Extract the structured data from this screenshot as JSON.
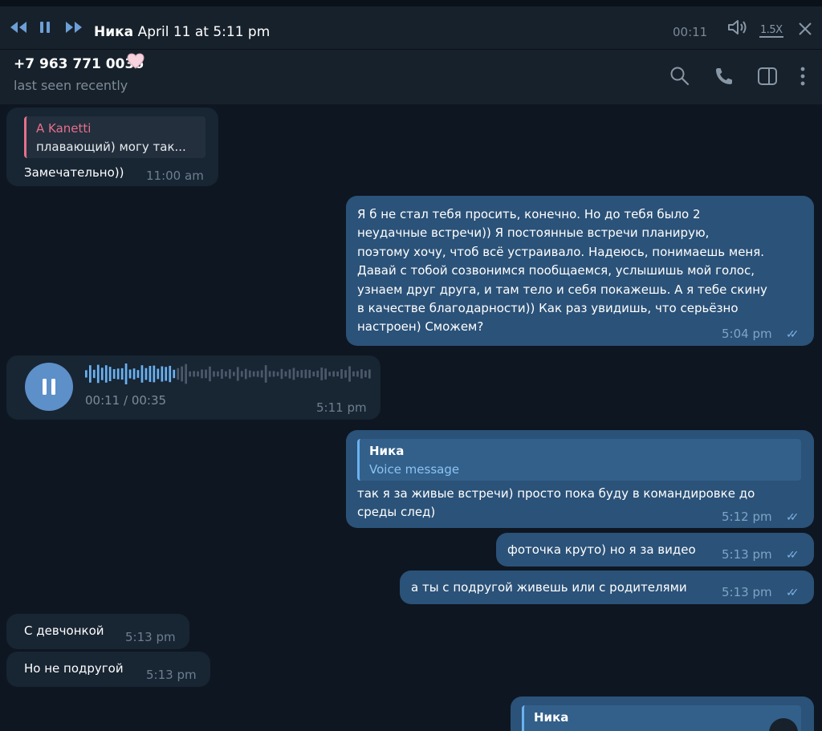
{
  "player": {
    "sender": "Ника",
    "date": "April 11 at 5:11 pm",
    "position": "00:11",
    "speed": "1.5X"
  },
  "chat": {
    "name": "+7 963 771 0036",
    "status": "last seen recently"
  },
  "messages": [
    {
      "reply_name": "A Kanetti",
      "reply_text": "плавающий) могу так...",
      "text": "Замечательно))",
      "time": "11:00 am"
    },
    {
      "lines": [
        "Я б не стал тебя просить, конечно. Но до тебя было 2",
        "неудачные встречи))  Я постоянные встречи планирую,",
        "поэтому хочу, чтоб всё устраивало. Надеюсь, понимаешь меня.",
        "Давай с тобой созвонимся пообщаемся, услышишь мой голос,",
        "узнаем друг друга, и там тело и себя покажешь.  А я тебе скину",
        "в качестве благодарности)) Как раз увидишь, что серьёзно",
        "настроен) Сможем?"
      ],
      "time": "5:04 pm"
    },
    {
      "voice_progress": "00:11 / 00:35",
      "voice_played_fraction": 0.31,
      "time": "5:11 pm"
    },
    {
      "reply_name": "Ника",
      "reply_text": "Voice message",
      "lines": [
        "так я за живые встречи) просто пока буду в командировке до",
        "среды след)"
      ],
      "time": "5:12 pm"
    },
    {
      "text": "фоточка круто) но я за видео",
      "time": "5:13 pm"
    },
    {
      "text": "а ты с подругой живешь или с родителями",
      "time": "5:13 pm"
    },
    {
      "text": "С девчонкой",
      "time": "5:13 pm"
    },
    {
      "text": "Но не подругой",
      "time": "5:13 pm"
    },
    {
      "reply_name": "Ника"
    }
  ],
  "icons": {
    "rewind": "rewind-icon",
    "pause": "pause-icon",
    "forward": "fast-forward-icon",
    "volume": "volume-icon",
    "close": "close-icon",
    "search": "search-icon",
    "call": "phone-icon",
    "sidebar": "sidebar-toggle-icon",
    "more": "more-vertical-icon",
    "heart": "heart-emoji"
  },
  "colors": {
    "background": "#0e1621",
    "header": "#17212b",
    "incoming": "#182533",
    "outgoing": "#2b5278",
    "accent": "#6ab2f2",
    "reply_name_pink": "#e76f8b"
  }
}
